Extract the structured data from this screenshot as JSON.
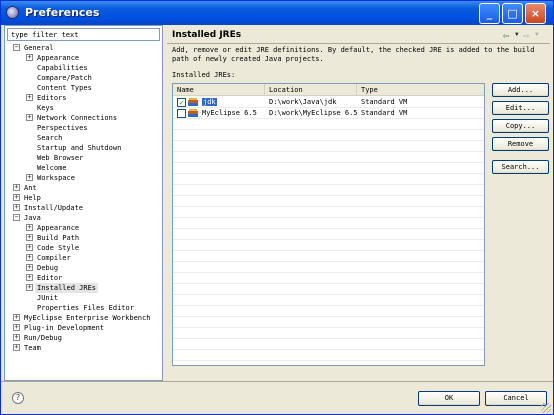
{
  "window": {
    "title": "Preferences",
    "icon": "eclipse-icon"
  },
  "filter": {
    "value": "type filter text"
  },
  "tree": [
    {
      "label": "General",
      "depth": 0,
      "toggle": "−"
    },
    {
      "label": "Appearance",
      "depth": 1,
      "toggle": "+"
    },
    {
      "label": "Capabilities",
      "depth": 1,
      "toggle": ""
    },
    {
      "label": "Compare/Patch",
      "depth": 1,
      "toggle": ""
    },
    {
      "label": "Content Types",
      "depth": 1,
      "toggle": ""
    },
    {
      "label": "Editors",
      "depth": 1,
      "toggle": "+"
    },
    {
      "label": "Keys",
      "depth": 1,
      "toggle": ""
    },
    {
      "label": "Network Connections",
      "depth": 1,
      "toggle": "+"
    },
    {
      "label": "Perspectives",
      "depth": 1,
      "toggle": ""
    },
    {
      "label": "Search",
      "depth": 1,
      "toggle": ""
    },
    {
      "label": "Startup and Shutdown",
      "depth": 1,
      "toggle": ""
    },
    {
      "label": "Web Browser",
      "depth": 1,
      "toggle": ""
    },
    {
      "label": "Welcome",
      "depth": 1,
      "toggle": ""
    },
    {
      "label": "Workspace",
      "depth": 1,
      "toggle": "+"
    },
    {
      "label": "Ant",
      "depth": 0,
      "toggle": "+"
    },
    {
      "label": "Help",
      "depth": 0,
      "toggle": "+"
    },
    {
      "label": "Install/Update",
      "depth": 0,
      "toggle": "+"
    },
    {
      "label": "Java",
      "depth": 0,
      "toggle": "−"
    },
    {
      "label": "Appearance",
      "depth": 1,
      "toggle": "+"
    },
    {
      "label": "Build Path",
      "depth": 1,
      "toggle": "+"
    },
    {
      "label": "Code Style",
      "depth": 1,
      "toggle": "+"
    },
    {
      "label": "Compiler",
      "depth": 1,
      "toggle": "+"
    },
    {
      "label": "Debug",
      "depth": 1,
      "toggle": "+"
    },
    {
      "label": "Editor",
      "depth": 1,
      "toggle": "+"
    },
    {
      "label": "Installed JREs",
      "depth": 1,
      "toggle": "+",
      "selected": true
    },
    {
      "label": "JUnit",
      "depth": 1,
      "toggle": ""
    },
    {
      "label": "Properties Files Editor",
      "depth": 1,
      "toggle": ""
    },
    {
      "label": "MyEclipse Enterprise Workbench",
      "depth": 0,
      "toggle": "+"
    },
    {
      "label": "Plug-in Development",
      "depth": 0,
      "toggle": "+"
    },
    {
      "label": "Run/Debug",
      "depth": 0,
      "toggle": "+"
    },
    {
      "label": "Team",
      "depth": 0,
      "toggle": "+"
    }
  ],
  "page": {
    "title": "Installed JREs",
    "description": "Add, remove or edit JRE definitions. By default, the checked JRE is added to the build path of newly created Java projects.",
    "table_label": "Installed JREs:",
    "columns": [
      "Name",
      "Location",
      "Type"
    ],
    "rows": [
      {
        "checked": true,
        "name": "jdk",
        "location": "D:\\work\\Java\\jdk",
        "type": "Standard VM",
        "selected": true
      },
      {
        "checked": false,
        "name": "MyEclipse 6.5",
        "location": "D:\\work\\MyEclipse 6.5",
        "type": "Standard VM",
        "selected": false
      }
    ]
  },
  "buttons": {
    "add": "Add...",
    "edit": "Edit...",
    "copy": "Copy...",
    "remove": "Remove",
    "search": "Search...",
    "ok": "OK",
    "cancel": "Cancel"
  },
  "help": "?",
  "caption": {
    "minimize": "_",
    "maximize": "□",
    "close": "×"
  },
  "nav": {
    "back": "⇦",
    "forward": "⇨",
    "menu": "▼"
  },
  "colors": {
    "titlebar": "#0a5ddc",
    "selection": "#316ac5",
    "face": "#ece9d8"
  }
}
